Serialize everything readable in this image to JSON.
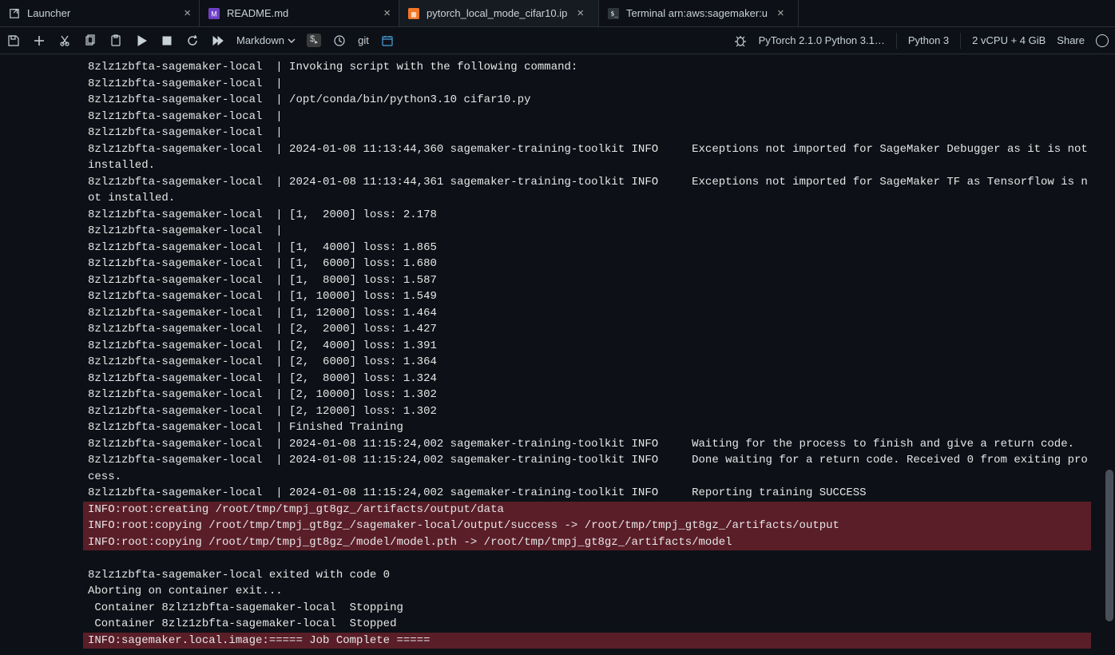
{
  "tabs": [
    {
      "label": "Launcher"
    },
    {
      "label": "README.md"
    },
    {
      "label": "pytorch_local_mode_cifar10.ip"
    },
    {
      "label": "Terminal arn:aws:sagemaker:u"
    }
  ],
  "toolbar": {
    "markdown_label": "Markdown",
    "git_label": "git"
  },
  "status": {
    "kernel_image": "PyTorch 2.1.0 Python 3.1…",
    "kernel_name": "Python 3",
    "instance": "2 vCPU + 4 GiB",
    "share": "Share"
  },
  "output": {
    "prefix": "8zlz1zbfta-sagemaker-local  | ",
    "lines": [
      "8zlz1zbfta-sagemaker-local  | Invoking script with the following command:",
      "8zlz1zbfta-sagemaker-local  | ",
      "8zlz1zbfta-sagemaker-local  | /opt/conda/bin/python3.10 cifar10.py",
      "8zlz1zbfta-sagemaker-local  | ",
      "8zlz1zbfta-sagemaker-local  | ",
      "8zlz1zbfta-sagemaker-local  | 2024-01-08 11:13:44,360 sagemaker-training-toolkit INFO     Exceptions not imported for SageMaker Debugger as it is not installed.",
      "8zlz1zbfta-sagemaker-local  | 2024-01-08 11:13:44,361 sagemaker-training-toolkit INFO     Exceptions not imported for SageMaker TF as Tensorflow is not installed.",
      "8zlz1zbfta-sagemaker-local  | [1,  2000] loss: 2.178",
      "8zlz1zbfta-sagemaker-local  | ",
      "8zlz1zbfta-sagemaker-local  | [1,  4000] loss: 1.865",
      "8zlz1zbfta-sagemaker-local  | [1,  6000] loss: 1.680",
      "8zlz1zbfta-sagemaker-local  | [1,  8000] loss: 1.587",
      "8zlz1zbfta-sagemaker-local  | [1, 10000] loss: 1.549",
      "8zlz1zbfta-sagemaker-local  | [1, 12000] loss: 1.464",
      "8zlz1zbfta-sagemaker-local  | [2,  2000] loss: 1.427",
      "8zlz1zbfta-sagemaker-local  | [2,  4000] loss: 1.391",
      "8zlz1zbfta-sagemaker-local  | [2,  6000] loss: 1.364",
      "8zlz1zbfta-sagemaker-local  | [2,  8000] loss: 1.324",
      "8zlz1zbfta-sagemaker-local  | [2, 10000] loss: 1.302",
      "8zlz1zbfta-sagemaker-local  | [2, 12000] loss: 1.302",
      "8zlz1zbfta-sagemaker-local  | Finished Training",
      "8zlz1zbfta-sagemaker-local  | 2024-01-08 11:15:24,002 sagemaker-training-toolkit INFO     Waiting for the process to finish and give a return code.",
      "8zlz1zbfta-sagemaker-local  | 2024-01-08 11:15:24,002 sagemaker-training-toolkit INFO     Done waiting for a return code. Received 0 from exiting process.",
      "8zlz1zbfta-sagemaker-local  | 2024-01-08 11:15:24,002 sagemaker-training-toolkit INFO     Reporting training SUCCESS"
    ],
    "highlight1": [
      "INFO:root:creating /root/tmp/tmpj_gt8gz_/artifacts/output/data",
      "INFO:root:copying /root/tmp/tmpj_gt8gz_/sagemaker-local/output/success -> /root/tmp/tmpj_gt8gz_/artifacts/output",
      "INFO:root:copying /root/tmp/tmpj_gt8gz_/model/model.pth -> /root/tmp/tmpj_gt8gz_/artifacts/model"
    ],
    "lines2": [
      "8zlz1zbfta-sagemaker-local exited with code 0",
      "Aborting on container exit...",
      " Container 8zlz1zbfta-sagemaker-local  Stopping",
      " Container 8zlz1zbfta-sagemaker-local  Stopped"
    ],
    "highlight2": [
      "INFO:sagemaker.local.image:===== Job Complete ====="
    ]
  }
}
